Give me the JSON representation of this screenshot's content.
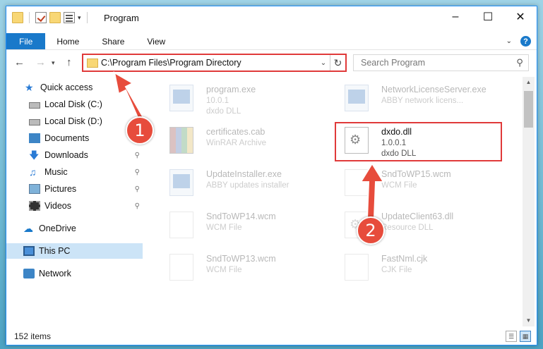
{
  "window": {
    "title": "Program"
  },
  "ribbon": {
    "tabs": [
      "File",
      "Home",
      "Share",
      "View"
    ],
    "help": "?"
  },
  "address": {
    "path": "C:\\Program Files\\Program Directory"
  },
  "search": {
    "placeholder": "Search Program"
  },
  "nav": {
    "items": [
      {
        "label": "Quick access",
        "icon": "star-icon"
      },
      {
        "label": "Local Disk (C:)",
        "icon": "drive-icon"
      },
      {
        "label": "Local Disk (D:)",
        "icon": "drive-icon"
      },
      {
        "label": "Documents",
        "icon": "document-icon"
      },
      {
        "label": "Downloads",
        "icon": "download-icon"
      },
      {
        "label": "Music",
        "icon": "music-icon"
      },
      {
        "label": "Pictures",
        "icon": "picture-icon"
      },
      {
        "label": "Videos",
        "icon": "video-icon"
      },
      {
        "label": "OneDrive",
        "icon": "cloud-icon"
      },
      {
        "label": "This PC",
        "icon": "computer-icon"
      },
      {
        "label": "Network",
        "icon": "network-icon"
      }
    ]
  },
  "files": [
    {
      "name": "program.exe",
      "line1": "10.0.1",
      "line2": "dxdo DLL"
    },
    {
      "name": "NetworkLicenseServer.exe",
      "line1": "ABBY network licens...",
      "line2": ""
    },
    {
      "name": "certificates.cab",
      "line1": "WinRAR Archive",
      "line2": ""
    },
    {
      "name": "dxdo.dll",
      "line1": "1.0.0.1",
      "line2": "dxdo DLL"
    },
    {
      "name": "UpdateInstaller.exe",
      "line1": "ABBY updates installer",
      "line2": ""
    },
    {
      "name": "SndToWP15.wcm",
      "line1": "WCM File",
      "line2": ""
    },
    {
      "name": "SndToWP14.wcm",
      "line1": "WCM File",
      "line2": ""
    },
    {
      "name": "UpdateClient63.dll",
      "line1": "Resource DLL",
      "line2": ""
    },
    {
      "name": "SndToWP13.wcm",
      "line1": "WCM File",
      "line2": ""
    },
    {
      "name": "FastNml.cjk",
      "line1": "CJK File",
      "line2": ""
    }
  ],
  "status": {
    "items_count": "152 items"
  },
  "annotations": {
    "step1": "1",
    "step2": "2",
    "color": "#e03a3a"
  }
}
